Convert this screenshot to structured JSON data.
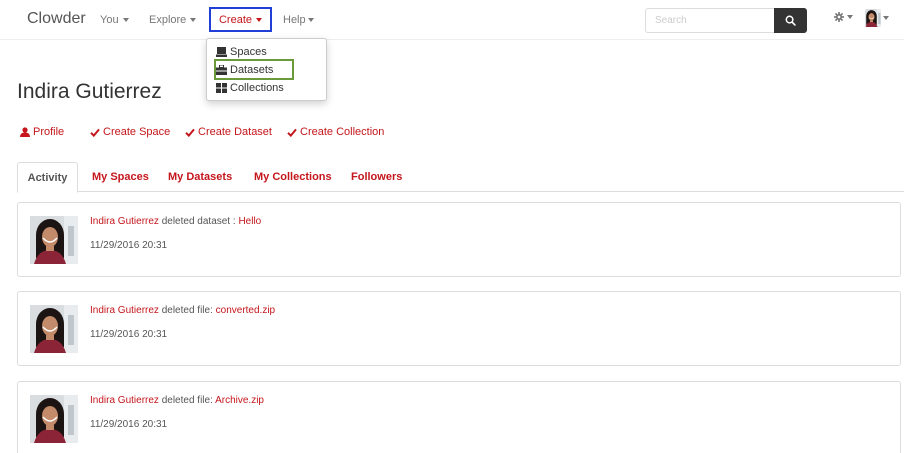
{
  "navbar": {
    "brand": "Clowder",
    "menus": [
      {
        "label": "You"
      },
      {
        "label": "Explore"
      },
      {
        "label": "Create"
      },
      {
        "label": "Help"
      }
    ],
    "search_placeholder": "Search"
  },
  "create_dropdown": {
    "items": [
      {
        "label": "Spaces",
        "icon": "spaces-icon"
      },
      {
        "label": "Datasets",
        "icon": "briefcase-icon"
      },
      {
        "label": "Collections",
        "icon": "collections-icon"
      }
    ]
  },
  "profile": {
    "name": "Indira Gutierrez",
    "actions": [
      {
        "label": "Profile",
        "icon": "user-icon"
      },
      {
        "label": "Create Space",
        "icon": "check-icon"
      },
      {
        "label": "Create Dataset",
        "icon": "check-icon"
      },
      {
        "label": "Create Collection",
        "icon": "check-icon"
      }
    ]
  },
  "tabs": [
    {
      "label": "Activity",
      "active": true
    },
    {
      "label": "My Spaces"
    },
    {
      "label": "My Datasets"
    },
    {
      "label": "My Collections"
    },
    {
      "label": "Followers"
    }
  ],
  "activity": [
    {
      "user": "Indira Gutierrez",
      "action": " deleted dataset : ",
      "target": "Hello",
      "time": "11/29/2016 20:31"
    },
    {
      "user": "Indira Gutierrez",
      "action": " deleted file: ",
      "target": "converted.zip",
      "time": "11/29/2016 20:31"
    },
    {
      "user": "Indira Gutierrez",
      "action": " deleted file: ",
      "target": "Archive.zip",
      "time": "11/29/2016 20:31"
    }
  ],
  "colors": {
    "accent": "#c4161c",
    "create_highlight": "#1f3fd6",
    "datasets_highlight": "#6a9a3a",
    "search_button": "#333333"
  }
}
